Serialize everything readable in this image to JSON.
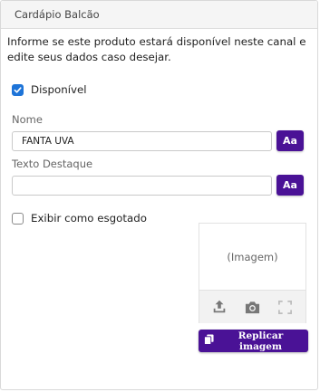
{
  "panel": {
    "title": "Cardápio Balcão",
    "intro": "Informe se este produto estará disponível neste canal e edite seus dados caso desejar."
  },
  "available": {
    "label": "Disponível",
    "checked": true
  },
  "name_field": {
    "label": "Nome",
    "value": "FANTA UVA",
    "format_label": "Aa"
  },
  "highlight_field": {
    "label": "Texto Destaque",
    "value": "",
    "format_label": "Aa"
  },
  "sold_out": {
    "label": "Exibir como esgotado",
    "checked": false
  },
  "image": {
    "placeholder": "(Imagem)",
    "tools": [
      "upload-icon",
      "camera-icon",
      "fullscreen-icon"
    ]
  },
  "replicate_button": {
    "label": "Replicar imagem",
    "icon": "copy-icon"
  },
  "colors": {
    "accent": "#4a1296",
    "checkbox": "#1e74d8"
  }
}
